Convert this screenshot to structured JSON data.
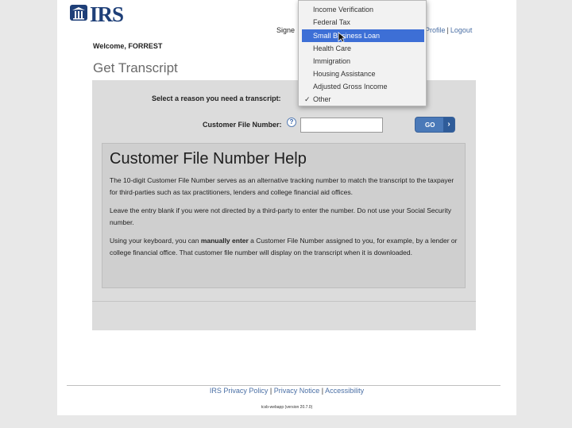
{
  "header": {
    "logo_text": "IRS",
    "signed_text": "Signe",
    "profile_link": "Profile",
    "logout_link": "Logout",
    "separator": "|"
  },
  "welcome": "Welcome, FORREST",
  "page_title": "Get Transcript",
  "form": {
    "reason_label": "Select a reason you need a transcript:",
    "cfn_label": "Customer File Number:",
    "help_marker": "?",
    "cfn_value": "",
    "go_label": "GO",
    "go_arrow": "›"
  },
  "dropdown": {
    "options": [
      "Income Verification",
      "Federal Tax",
      "Small Business Loan",
      "Health Care",
      "Immigration",
      "Housing Assistance",
      "Adjusted Gross Income",
      "Other"
    ],
    "highlighted": "Small Business Loan",
    "checked": "Other",
    "check_mark": "✓"
  },
  "help": {
    "title": "Customer File Number Help",
    "para1": "The 10-digit Customer File Number serves as an alternative tracking number to match the transcript to the taxpayer for third-parties such as tax practitioners, lenders and college financial aid offices.",
    "para2": "Leave the entry blank if you were not directed by a third-party to enter the number. Do not use your Social Security number.",
    "para3_before": "Using your keyboard, you can ",
    "para3_bold": "manually enter",
    "para3_after": " a Customer File Number assigned to you, for example, by a lender or college financial office. That customer file number will display on the transcript when it is downloaded."
  },
  "footer": {
    "privacy_policy": "IRS Privacy Policy",
    "privacy_notice": "Privacy Notice",
    "accessibility": "Accessibility",
    "separator": "|",
    "version": "tcsb-webapp (version 20.7.0)"
  },
  "colors": {
    "brand_blue": "#1e3f78",
    "link_blue": "#4a6fa5",
    "selected_bg": "#3d6fd6",
    "button_blue": "#4a79b8"
  },
  "icons": [
    "irs-eagle-icon",
    "help-icon",
    "chevron-right-icon",
    "checkmark-icon",
    "mouse-cursor-icon"
  ]
}
